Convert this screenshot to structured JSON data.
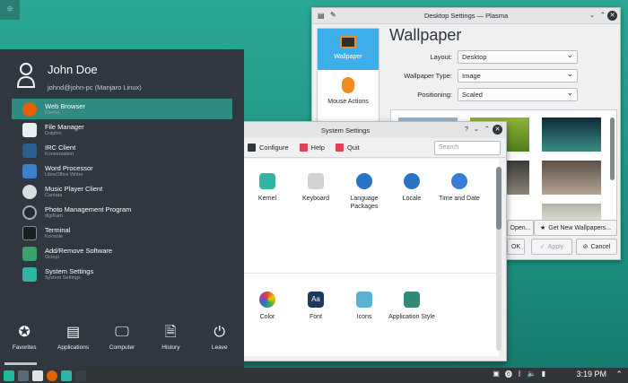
{
  "menu": {
    "user": {
      "name": "John Doe",
      "email": "johnd@john-pc (Manjaro Linux)"
    },
    "items": [
      {
        "title": "Web Browser",
        "subtitle": "Firefox",
        "icon": "firefox-icon",
        "color": "#e66000"
      },
      {
        "title": "File Manager",
        "subtitle": "Dolphin",
        "icon": "folder-icon",
        "color": "#e9eef2"
      },
      {
        "title": "IRC Client",
        "subtitle": "Konversation",
        "icon": "irc-icon",
        "color": "#2b5f8a"
      },
      {
        "title": "Word Processor",
        "subtitle": "LibreOffice Writer",
        "icon": "writer-icon",
        "color": "#3d7fd0"
      },
      {
        "title": "Music Player Client",
        "subtitle": "Cantata",
        "icon": "music-icon",
        "color": "#d8dde2"
      },
      {
        "title": "Photo Management Program",
        "subtitle": "digiKam",
        "icon": "digikam-icon",
        "color": "#222a33"
      },
      {
        "title": "Terminal",
        "subtitle": "Konsole",
        "icon": "terminal-icon",
        "color": "#1b1e21"
      },
      {
        "title": "Add/Remove Software",
        "subtitle": "Octopi",
        "icon": "package-icon",
        "color": "#3aa36c"
      },
      {
        "title": "System Settings",
        "subtitle": "System Settings",
        "icon": "settings-icon",
        "color": "#2fb5a3"
      }
    ],
    "tabs": [
      {
        "label": "Favorites",
        "icon": "star-icon"
      },
      {
        "label": "Applications",
        "icon": "applications-icon"
      },
      {
        "label": "Computer",
        "icon": "computer-icon"
      },
      {
        "label": "History",
        "icon": "history-icon"
      },
      {
        "label": "Leave",
        "icon": "leave-icon"
      }
    ]
  },
  "desktop_settings": {
    "window_title": "Desktop Settings — Plasma",
    "sidebar": [
      "Wallpaper",
      "Mouse Actions"
    ],
    "heading": "Wallpaper",
    "fields": [
      {
        "label": "Layout:",
        "value": "Desktop"
      },
      {
        "label": "Wallpaper Type:",
        "value": "Image"
      },
      {
        "label": "Positioning:",
        "value": "Scaled"
      }
    ],
    "buttons": {
      "open": "Open...",
      "get_new": "Get New Wallpapers...",
      "ok": "OK",
      "apply": "Apply",
      "cancel": "Cancel"
    }
  },
  "system_settings": {
    "window_title": "System Settings",
    "toolbar": {
      "configure": "Configure",
      "help": "Help",
      "quit": "Quit"
    },
    "search_placeholder": "Search",
    "row1": [
      {
        "label": "Kernel",
        "icon": "kernel-icon",
        "color": "#2fb5a3"
      },
      {
        "label": "Keyboard",
        "icon": "keyboard-icon",
        "color": "#cfd3d6"
      },
      {
        "label": "Language Packages",
        "icon": "globe-icon",
        "color": "#2b73c7"
      },
      {
        "label": "Locale",
        "icon": "locale-icon",
        "color": "#2b73c7"
      },
      {
        "label": "Time and Date",
        "icon": "clock-icon",
        "color": "#3a7bd5"
      }
    ],
    "row2": [
      {
        "label": "Color",
        "icon": "color-icon",
        "color": "#e0462f"
      },
      {
        "label": "Font",
        "icon": "font-icon",
        "color": "#1e3a5c"
      },
      {
        "label": "Icons",
        "icon": "icons-icon",
        "color": "#5bb0d8"
      },
      {
        "label": "Application Style",
        "icon": "app-style-icon",
        "color": "#2e8b7a"
      }
    ]
  },
  "taskbar": {
    "clock": "3:19 PM"
  }
}
